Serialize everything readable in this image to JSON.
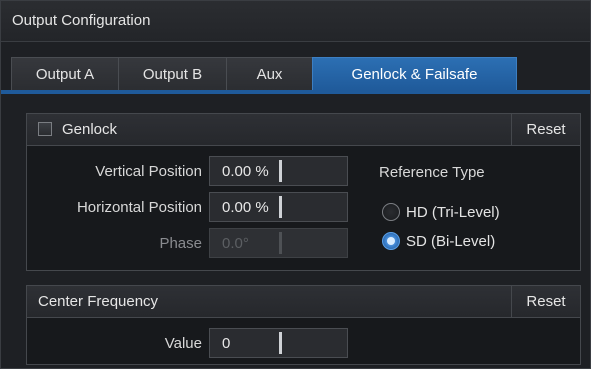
{
  "window": {
    "title": "Output Configuration"
  },
  "tabs": [
    {
      "label": "Output A",
      "active": false
    },
    {
      "label": "Output B",
      "active": false
    },
    {
      "label": "Aux",
      "active": false
    },
    {
      "label": "Genlock & Failsafe",
      "active": true
    }
  ],
  "genlock": {
    "label": "Genlock",
    "enabled": false,
    "reset_label": "Reset",
    "vertical_position": {
      "label": "Vertical Position",
      "value": "0.00 %"
    },
    "horizontal_position": {
      "label": "Horizontal Position",
      "value": "0.00 %"
    },
    "phase": {
      "label": "Phase",
      "value": "0.0°",
      "disabled": true
    },
    "reference_type": {
      "label": "Reference Type",
      "options": [
        {
          "label": "HD (Tri-Level)",
          "selected": false
        },
        {
          "label": "SD (Bi-Level)",
          "selected": true
        }
      ]
    }
  },
  "center_frequency": {
    "label": "Center Frequency",
    "reset_label": "Reset",
    "value_field": {
      "label": "Value",
      "value": "0"
    }
  },
  "colors": {
    "accent": "#1f5a9a",
    "panel_bg": "#17191c",
    "window_bg": "#1e2024"
  }
}
